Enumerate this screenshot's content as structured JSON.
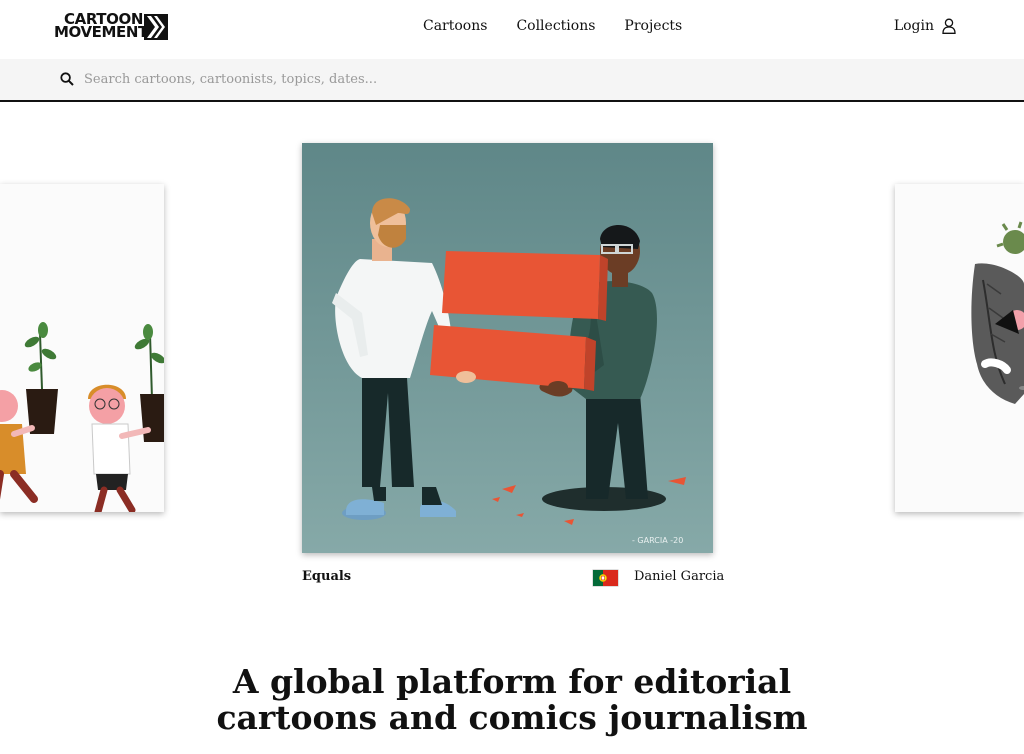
{
  "brand": {
    "line1": "CARTOON",
    "line2": "MOVEMENT"
  },
  "nav": {
    "items": [
      {
        "label": "Cartoons"
      },
      {
        "label": "Collections"
      },
      {
        "label": "Projects"
      }
    ]
  },
  "header": {
    "login_label": "Login",
    "login_icon": "user-icon"
  },
  "search": {
    "placeholder": "Search cartoons, cartoonists, topics, dates...",
    "value": "",
    "icon": "search-icon"
  },
  "featured": {
    "title": "Equals",
    "author": "Daniel Garcia",
    "country_flag": "portugal-flag",
    "signature": "- GARCIA -20"
  },
  "tagline": {
    "line1": "A global platform for editorial",
    "line2": "cartoons and comics journalism"
  },
  "colors": {
    "accent_red": "#e85535",
    "panel_teal": "#6f9697",
    "text": "#111111",
    "search_bg": "#f5f5f5"
  }
}
